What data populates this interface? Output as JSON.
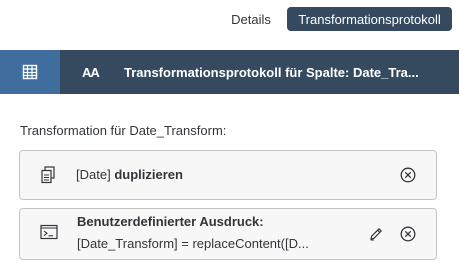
{
  "tabs": {
    "details_label": "Details",
    "active_label": "Transformationsprotokoll"
  },
  "header": {
    "type_icon_text": "AA",
    "title": "Transformationsprotokoll für Spalte: Date_Tra..."
  },
  "section": {
    "label": "Transformation für Date_Transform:"
  },
  "steps": [
    {
      "icon": "copy-icon",
      "prefix": "[Date]",
      "action": "duplizieren"
    },
    {
      "icon": "console-icon",
      "title": "Benutzerdefinierter Ausdruck:",
      "expression": "[Date_Transform] = replaceContent([D..."
    }
  ],
  "colors": {
    "header_bg": "#354a5f",
    "grid_button_bg": "#3f6e9e",
    "active_tab_bg": "#354a5f",
    "card_bg": "#f7f7f7",
    "card_border": "#c3c3c3"
  }
}
